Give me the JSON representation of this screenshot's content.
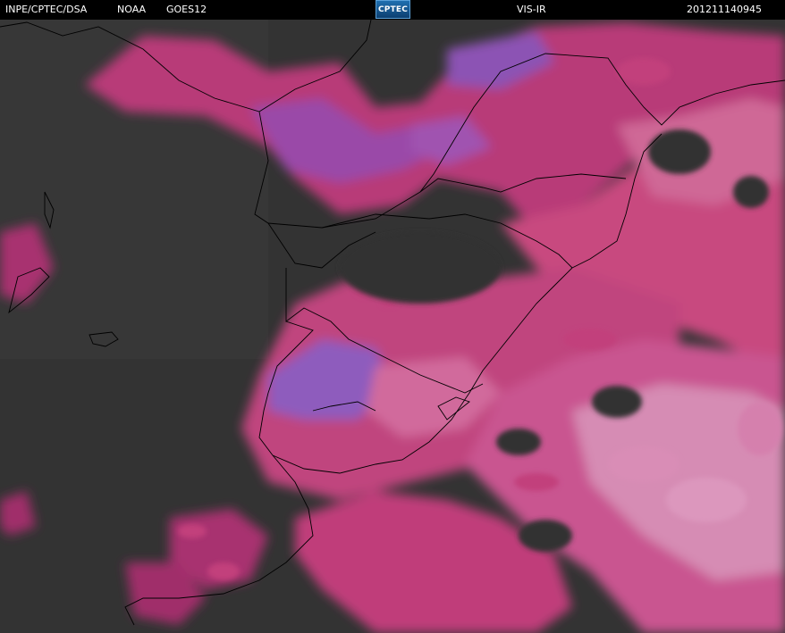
{
  "header": {
    "agency": "INPE/CPTEC/DSA",
    "noaa": "NOAA",
    "satellite": "GOES12",
    "logo_text": "CPTEC",
    "channel": "VIS-IR",
    "timestamp": "201211140945"
  },
  "colors": {
    "background": "#333333",
    "cloud_magenta": "#c03c7a",
    "cloud_purple": "#8a4fb0",
    "cloud_pale": "#d07aa8",
    "coastline": "#000000"
  }
}
